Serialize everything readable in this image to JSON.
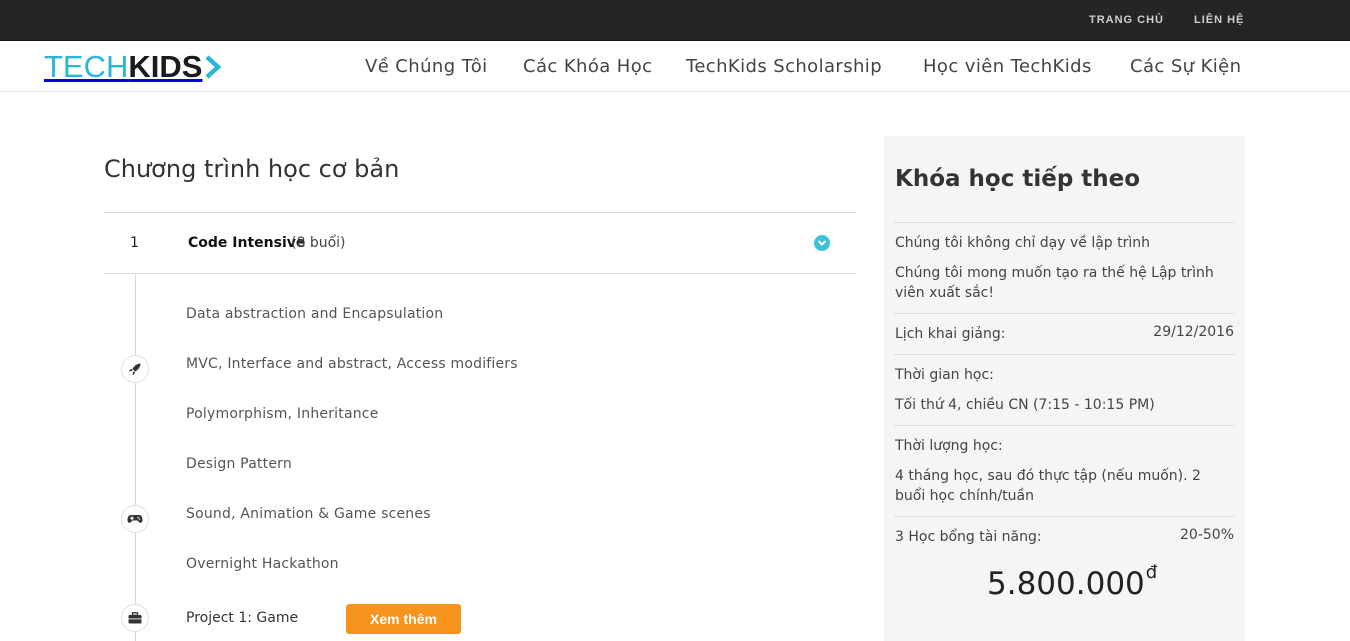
{
  "topbar": {
    "home": "TRANG CHỦ",
    "contact": "LIÊN HỆ"
  },
  "logo": {
    "part1": "TECH",
    "part2": "KIDS"
  },
  "nav": [
    "Về Chúng Tôi",
    "Các Khóa Học",
    "TechKids Scholarship",
    "Học viên TechKids",
    "Các Sự Kiện"
  ],
  "main": {
    "title": "Chương trình học cơ bản",
    "course": {
      "number": "1",
      "name": "Code Intensive",
      "sessions": "(8 buổi)"
    },
    "topics": [
      "Data abstraction and Encapsulation",
      "MVC, Interface and abstract, Access modifiers",
      "Polymorphism, Inheritance",
      "Design Pattern",
      "Sound, Animation & Game scenes",
      "Overnight Hackathon"
    ],
    "timeline_icons": [
      "rocket-icon",
      "gamepad-icon",
      "briefcase-icon"
    ],
    "project": {
      "label": "Project 1: Game",
      "button": "Xem thêm"
    }
  },
  "sidebar": {
    "title": "Khóa học tiếp theo",
    "intro1": "Chúng tôi không chỉ dạy về lập trình",
    "intro2": "Chúng tôi mong muốn tạo ra thế hệ Lập trình viên xuất sắc!",
    "start_label": "Lịch khai giảng:",
    "start_value": "29/12/2016",
    "time_label": "Thời gian học:",
    "time_value": "Tối thứ 4, chiều CN (7:15 - 10:15 PM)",
    "duration_label": "Thời lượng học:",
    "duration_value": "4 tháng học, sau đó thực tập (nếu muốn). 2 buổi học chính/tuần",
    "scholarship_label": "3 Học bổng tài năng:",
    "scholarship_value": "20-50%",
    "price": "5.800.000",
    "currency": "đ"
  },
  "colors": {
    "accent": "#2ab7d6",
    "button": "#f7941d",
    "topbar": "#252525"
  }
}
